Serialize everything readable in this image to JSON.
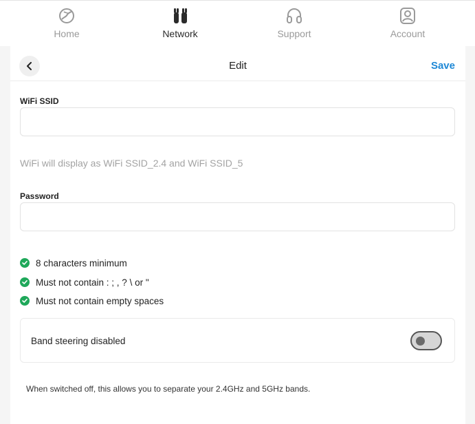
{
  "nav": {
    "items": [
      {
        "label": "Home",
        "icon": "globe-icon",
        "active": false
      },
      {
        "label": "Network",
        "icon": "network-icon",
        "active": true
      },
      {
        "label": "Support",
        "icon": "headset-icon",
        "active": false
      },
      {
        "label": "Account",
        "icon": "user-icon",
        "active": false
      }
    ]
  },
  "header": {
    "title": "Edit",
    "save_label": "Save",
    "back_icon": "chevron-left-icon"
  },
  "form": {
    "ssid_label": "WiFi SSID",
    "ssid_value": "",
    "ssid_hint": "WiFi will display as WiFi SSID_2.4 and WiFi SSID_5",
    "password_label": "Password",
    "password_value": ""
  },
  "password_rules": [
    {
      "text": "8 characters minimum",
      "met": true
    },
    {
      "text": "Must not contain : ; , ? \\ or \"",
      "met": true
    },
    {
      "text": "Must not contain empty spaces",
      "met": true
    }
  ],
  "band_steering": {
    "label": "Band steering disabled",
    "enabled": false
  },
  "footnote": "When switched off, this allows you to separate your 2.4GHz and 5GHz bands.",
  "colors": {
    "accent": "#1e88d6",
    "success": "#1fa85a",
    "active_nav": "#2b2b2b",
    "inactive_nav": "#9a9a9a"
  }
}
